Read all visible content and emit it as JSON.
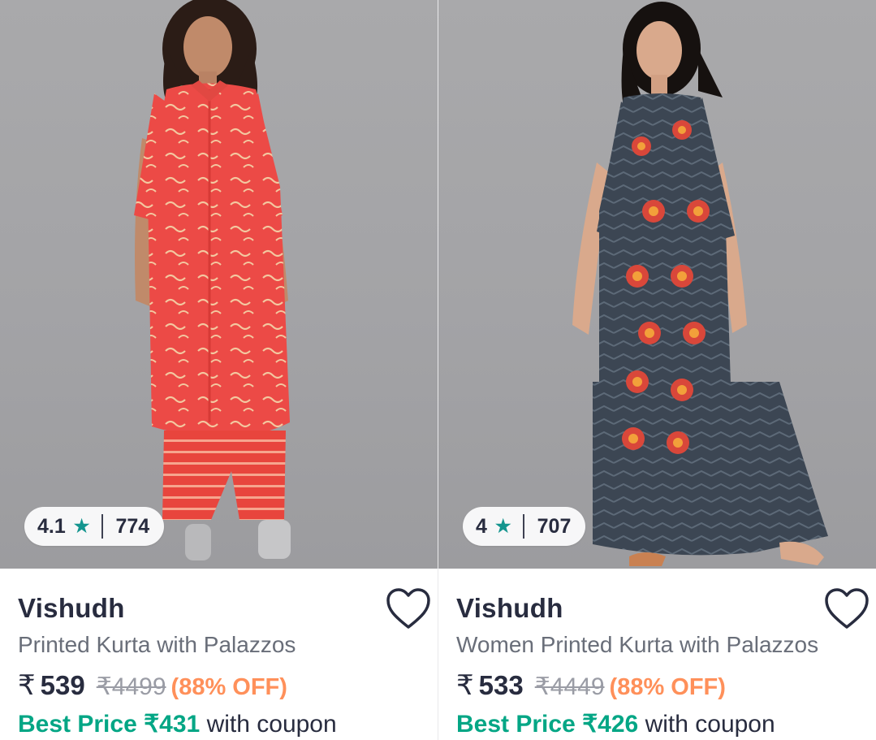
{
  "colors": {
    "accent_green": "#03a685",
    "discount_orange": "#ff905a",
    "star_teal": "#14958f",
    "text_dark": "#282c3f",
    "text_muted": "#696e79"
  },
  "products": [
    {
      "image_alt": "Woman wearing red printed kurta with striped palazzos",
      "rating": "4.1",
      "rating_icon": "star-icon",
      "rating_count": "774",
      "brand": "Vishudh",
      "title": "Printed Kurta with Palazzos",
      "currency": "₹",
      "price": "539",
      "mrp": "₹4499",
      "discount": "(88% OFF)",
      "best_label": "Best Price ₹431",
      "best_suffix": " with coupon",
      "wishlist_icon": "heart-outline-icon"
    },
    {
      "image_alt": "Woman wearing grey chevron kurta with floral motifs and palazzos",
      "rating": "4",
      "rating_icon": "star-icon",
      "rating_count": "707",
      "brand": "Vishudh",
      "title": "Women Printed Kurta with Palazzos",
      "currency": "₹",
      "price": "533",
      "mrp": "₹4449",
      "discount": "(88% OFF)",
      "best_label": "Best Price ₹426",
      "best_suffix": " with coupon",
      "wishlist_icon": "heart-outline-icon"
    }
  ]
}
